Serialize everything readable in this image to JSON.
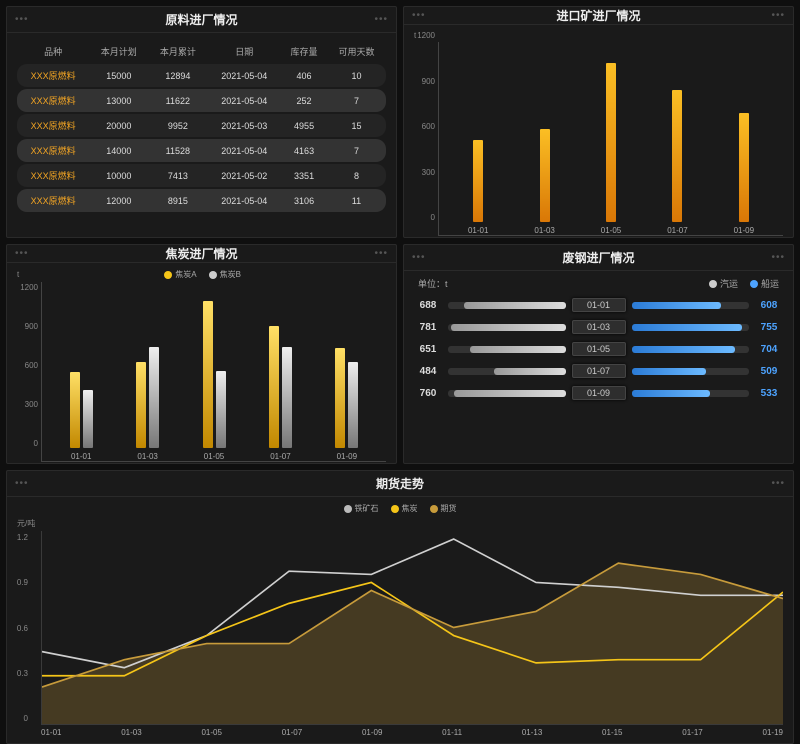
{
  "panels": {
    "raw": {
      "title": "原料进厂情况"
    },
    "ore": {
      "title": "进口矿进厂情况"
    },
    "coke": {
      "title": "焦炭进厂情况"
    },
    "scrap": {
      "title": "废钢进厂情况"
    },
    "futures": {
      "title": "期货走势"
    }
  },
  "raw_table": {
    "headers": [
      "品种",
      "本月计划",
      "本月累计",
      "日期",
      "库存量",
      "可用天数"
    ],
    "rows": [
      {
        "name": "XXX原燃料",
        "plan": "15000",
        "acc": "12894",
        "date": "2021-05-04",
        "stock": "406",
        "days": "10"
      },
      {
        "name": "XXX原燃料",
        "plan": "13000",
        "acc": "11622",
        "date": "2021-05-04",
        "stock": "252",
        "days": "7"
      },
      {
        "name": "XXX原燃料",
        "plan": "20000",
        "acc": "9952",
        "date": "2021-05-03",
        "stock": "4955",
        "days": "15"
      },
      {
        "name": "XXX原燃料",
        "plan": "14000",
        "acc": "11528",
        "date": "2021-05-04",
        "stock": "4163",
        "days": "7"
      },
      {
        "name": "XXX原燃料",
        "plan": "10000",
        "acc": "7413",
        "date": "2021-05-02",
        "stock": "3351",
        "days": "8"
      },
      {
        "name": "XXX原燃料",
        "plan": "12000",
        "acc": "8915",
        "date": "2021-05-04",
        "stock": "3106",
        "days": "11"
      }
    ]
  },
  "chart_data": [
    {
      "id": "ore_chart",
      "type": "bar",
      "title": "进口矿进厂情况",
      "unit": "t",
      "categories": [
        "01-01",
        "01-03",
        "01-05",
        "01-07",
        "01-09"
      ],
      "values": [
        550,
        620,
        1060,
        880,
        730
      ],
      "ylim": [
        0,
        1200
      ],
      "yticks": [
        0,
        300,
        600,
        900,
        1200
      ]
    },
    {
      "id": "coke_chart",
      "type": "bar",
      "title": "焦炭进厂情况",
      "unit": "t",
      "categories": [
        "01-01",
        "01-03",
        "01-05",
        "01-07",
        "01-09"
      ],
      "series": [
        {
          "name": "焦炭A",
          "values": [
            550,
            620,
            1060,
            880,
            720
          ]
        },
        {
          "name": "焦炭B",
          "values": [
            420,
            730,
            560,
            730,
            620
          ]
        }
      ],
      "ylim": [
        0,
        1200
      ],
      "yticks": [
        0,
        300,
        600,
        900,
        1200
      ]
    },
    {
      "id": "scrap_chart",
      "type": "bar",
      "title": "废钢进厂情况",
      "unit_label": "单位：t",
      "categories": [
        "01-01",
        "01-03",
        "01-05",
        "01-07",
        "01-09"
      ],
      "series": [
        {
          "name": "汽运",
          "values": [
            688,
            781,
            651,
            484,
            760
          ]
        },
        {
          "name": "船运",
          "values": [
            608,
            755,
            704,
            509,
            533
          ]
        }
      ],
      "max": 800
    },
    {
      "id": "futures_chart",
      "type": "line",
      "title": "期货走势",
      "unit": "元/吨",
      "categories": [
        "01-01",
        "01-03",
        "01-05",
        "01-07",
        "01-09",
        "01-11",
        "01-13",
        "01-15",
        "01-17",
        "01-19"
      ],
      "series": [
        {
          "name": "铁矿石",
          "color": "#d0d0d0",
          "values": [
            0.45,
            0.35,
            0.55,
            0.95,
            0.93,
            1.15,
            0.88,
            0.85,
            0.8,
            0.8
          ]
        },
        {
          "name": "焦炭",
          "color": "#f5c518",
          "values": [
            0.3,
            0.3,
            0.55,
            0.75,
            0.88,
            0.55,
            0.38,
            0.4,
            0.4,
            0.82
          ]
        },
        {
          "name": "期货",
          "color": "#c79b3b",
          "values": [
            0.23,
            0.4,
            0.5,
            0.5,
            0.83,
            0.6,
            0.7,
            1.0,
            0.93,
            0.78
          ]
        }
      ],
      "ylim": [
        0,
        1.2
      ],
      "yticks": [
        0,
        0.3,
        0.6,
        0.9,
        1.2
      ]
    }
  ]
}
